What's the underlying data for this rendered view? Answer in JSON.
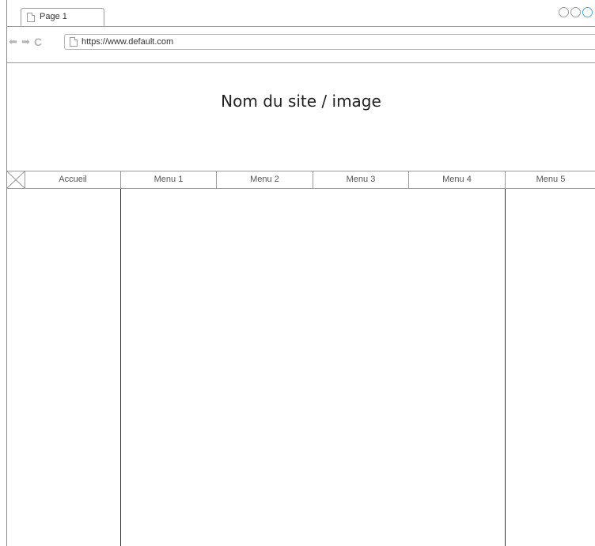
{
  "browser": {
    "tab_label": "Page 1",
    "url": "https://www.default.com"
  },
  "site": {
    "title": "Nom du site / image"
  },
  "menu": {
    "items": [
      "Accueil",
      "Menu 1",
      "Menu 2",
      "Menu 3",
      "Menu 4",
      "Menu 5"
    ]
  },
  "icons": {
    "back": "arrow-left-icon",
    "forward": "arrow-right-icon",
    "reload": "reload-icon",
    "page": "page-icon",
    "image_placeholder": "image-placeholder-icon"
  },
  "colors": {
    "border": "#9a9a9a",
    "accent_control": "#4aa8d8",
    "nav_icon": "#b4b4b4"
  }
}
